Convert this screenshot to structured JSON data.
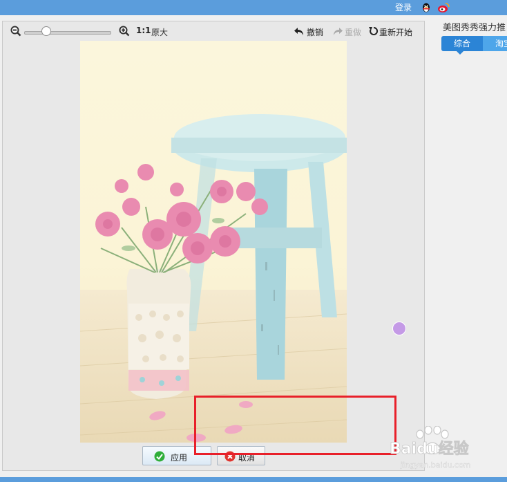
{
  "header": {
    "login_label": "登录"
  },
  "toolbar": {
    "ratio_label": "1:1",
    "original_size_label": "原大",
    "undo_label": "撤销",
    "redo_label": "重做",
    "reset_label": "重新开始"
  },
  "zoom_slider": {
    "level": 0.25
  },
  "actions": {
    "apply_label": "应用",
    "cancel_label": "取消"
  },
  "side_panel": {
    "title": "美图秀秀强力推",
    "tabs": [
      {
        "label": "综合",
        "active": true
      },
      {
        "label": "淘宝",
        "active": false
      }
    ]
  },
  "watermark": {
    "text_main": "Baidu经验",
    "text_sub": "jingyan.baidu.com"
  },
  "colors": {
    "accent": "#5b9ddc",
    "tab_active": "#2b84d6",
    "highlight_box": "#e8202a",
    "handle": "#c49ae6"
  }
}
